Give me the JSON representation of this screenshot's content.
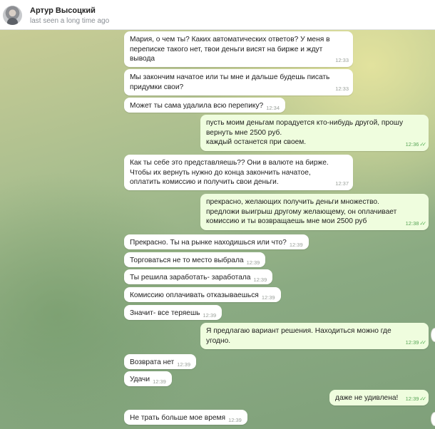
{
  "header": {
    "contact_name": "Артур Высоцкий",
    "status": "last seen a long time ago"
  },
  "messages": [
    {
      "dir": "in",
      "text": "Мария, о чем ты? Каких автоматических ответов? У меня в\nпереписке такого нет, твои деньги висят на бирже и ждут\nвывода",
      "time": "12:33"
    },
    {
      "dir": "in",
      "text": "Мы закончим начатое или ты мне и дальше будешь писать\nпридумки свои?",
      "time": "12:33"
    },
    {
      "dir": "in",
      "text": "Может ты сама удалила всю перепику?",
      "time": "12:34"
    },
    {
      "dir": "out",
      "text": "пусть моим деньгам порадуется кто-нибудь другой, прошу\nвернуть мне 2500 руб.\nкаждый останется при своем.",
      "time": "12:36",
      "read": "✓✓"
    },
    {
      "dir": "in",
      "text": "Как ты себе это представляешь?? Они в валюте на бирже.\nЧтобы их вернуть нужно до конца закончить начатое,\nоплатить комиссию и получить свои деньги.",
      "time": "12:37"
    },
    {
      "dir": "out",
      "text": "прекрасно, желающих получить деньги множество.\nпредложи выигрыш другому желающему, он оплачивает\nкомиссию и ты возвращаешь мне мои 2500 руб",
      "time": "12:38",
      "read": "✓✓"
    },
    {
      "dir": "in",
      "text": "Прекрасно. Ты на рынке находишься или что?",
      "time": "12:39"
    },
    {
      "dir": "in",
      "text": "Торговаться не то место выбрала",
      "time": "12:39"
    },
    {
      "dir": "in",
      "text": "Ты решила заработать- заработала",
      "time": "12:39"
    },
    {
      "dir": "in",
      "text": "Комиссию оплачивать отказываешься",
      "time": "12:39"
    },
    {
      "dir": "in",
      "text": "Значит- все теряешь",
      "time": "12:39"
    },
    {
      "dir": "out",
      "text": "Я предлагаю вариант решения. Находиться можно где\nугодно.",
      "time": "12:39",
      "read": "✓✓"
    },
    {
      "dir": "in",
      "text": "Возврата нет",
      "time": "12:39"
    },
    {
      "dir": "in",
      "text": "Удачи",
      "time": "12:39"
    },
    {
      "dir": "out",
      "text": "даже не удивлена!",
      "time": "12:39",
      "read": "✓✓"
    },
    {
      "dir": "in",
      "text": "Не трать больше мое время",
      "time": "12:39"
    }
  ]
}
